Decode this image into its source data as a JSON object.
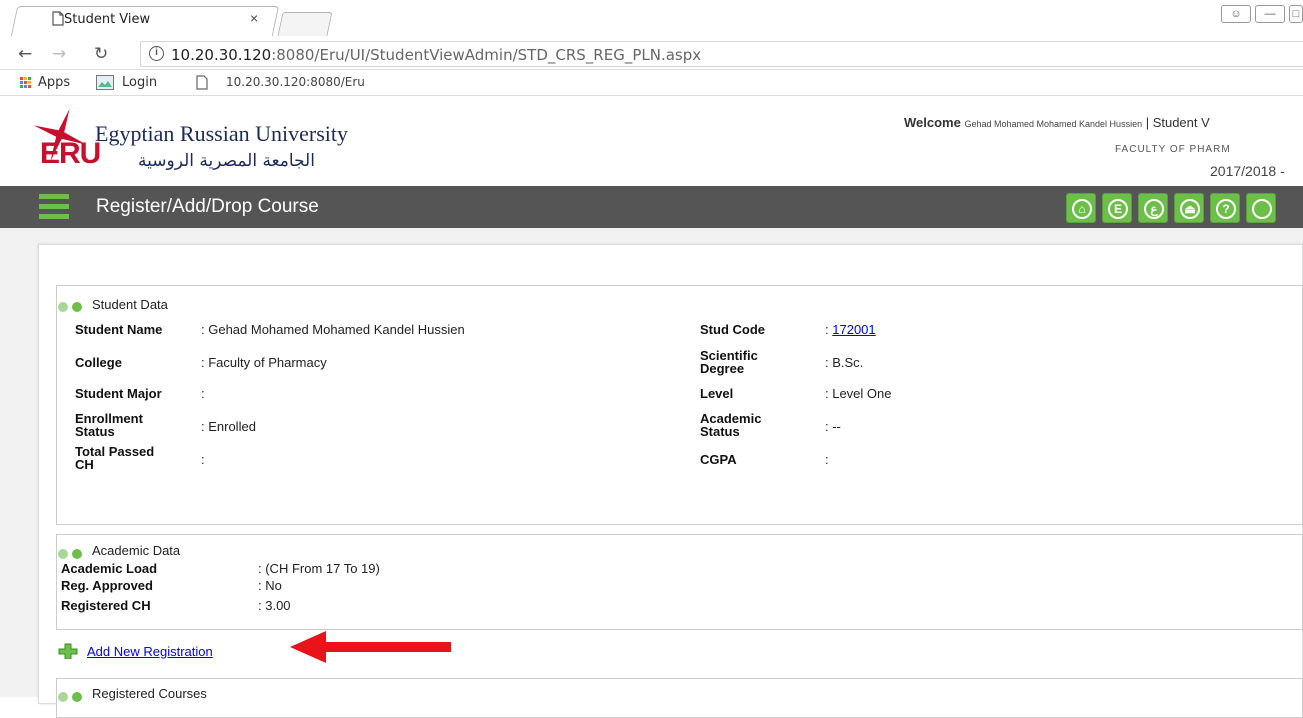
{
  "browser": {
    "tab_title": "Student View",
    "tab_close": "×",
    "url_host": "10.20.30.120",
    "url_rest": ":8080/Eru/UI/StudentViewAdmin/STD_CRS_REG_PLN.aspx",
    "bookmarks": [
      {
        "label": "Apps"
      },
      {
        "label": "Login"
      },
      {
        "label": "10.20.30.120:8080/Eru"
      }
    ]
  },
  "header": {
    "logo_abbr": "ERU",
    "university_en": "Egyptian Russian University",
    "university_ar": "الجامعة المصرية الروسية",
    "welcome_label": "Welcome",
    "welcome_name": "Gehad Mohamed Mohamed Kandel Hussien",
    "welcome_suffix": "| Student V",
    "faculty": "FACULTY OF PHARM",
    "year": "2017/2018  -"
  },
  "titlebar": {
    "title": "Register/Add/Drop Course",
    "tools": [
      {
        "icon": "home-icon",
        "glyph": "⌂"
      },
      {
        "icon": "english-icon",
        "glyph": "E"
      },
      {
        "icon": "arabic-icon",
        "glyph": "ع"
      },
      {
        "icon": "lock-icon",
        "glyph": "⏏"
      },
      {
        "icon": "help-icon",
        "glyph": "?"
      },
      {
        "icon": "more-icon",
        "glyph": ""
      }
    ]
  },
  "student_data": {
    "heading": "Student Data",
    "student_name_label": "Student Name",
    "student_name": ": Gehad Mohamed Mohamed Kandel Hussien",
    "stud_code_label": "Stud Code",
    "stud_code_colon": ":",
    "stud_code": "172001",
    "college_label": "College",
    "college": ": Faculty of Pharmacy",
    "degree_label_1": "Scientific",
    "degree_label_2": "Degree",
    "degree": ": B.Sc.",
    "major_label": "Student Major",
    "major": ":",
    "level_label": "Level",
    "level": ": Level One",
    "enroll_label_1": "Enrollment",
    "enroll_label_2": "Status",
    "enroll": ": Enrolled",
    "acad_status_label_1": "Academic",
    "acad_status_label_2": "Status",
    "acad_status": ": --",
    "passed_label_1": "Total Passed",
    "passed_label_2": "CH",
    "passed": ":",
    "cgpa_label": "CGPA",
    "cgpa": ":"
  },
  "academic_data": {
    "heading": "Academic Data",
    "load_label": "Academic Load",
    "load": ": (CH From 17 To 19)",
    "approved_label": "Reg. Approved",
    "approved": ": No",
    "registered_label": "Registered CH",
    "registered": ": 3.00"
  },
  "actions": {
    "add_registration": "Add New Registration"
  },
  "registered_courses": {
    "heading": "Registered Courses"
  },
  "colors": {
    "accent_green": "#6cc04a",
    "titlebar_bg": "#555555",
    "arrow_red": "#e8141a"
  }
}
